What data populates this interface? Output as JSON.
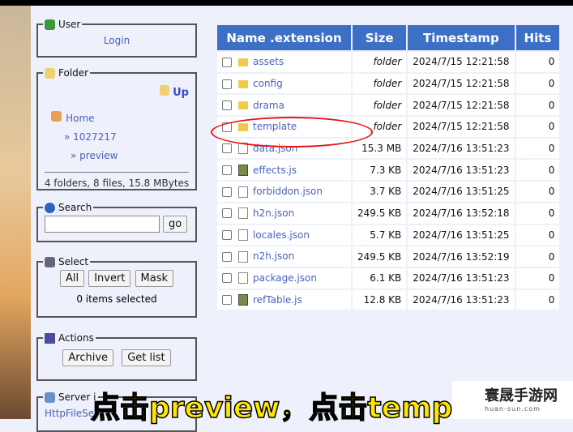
{
  "sidebar": {
    "user": {
      "title": "User",
      "login": "Login"
    },
    "folder": {
      "title": "Folder",
      "up": "Up",
      "home": "Home",
      "path": [
        "» 1027217",
        "» preview"
      ],
      "summary": "4 folders, 8 files, 15.8 MBytes"
    },
    "search": {
      "title": "Search",
      "value": "",
      "go": "go"
    },
    "select": {
      "title": "Select",
      "all": "All",
      "invert": "Invert",
      "mask": "Mask",
      "status": "0 items selected"
    },
    "actions": {
      "title": "Actions",
      "archive": "Archive",
      "getlist": "Get list"
    },
    "server": {
      "title": "Server i",
      "link": "HttpFileSe"
    }
  },
  "table": {
    "headers": [
      "Name .extension",
      "Size",
      "Timestamp",
      "Hits"
    ],
    "rows": [
      {
        "name": "assets",
        "type": "folder",
        "size": "folder",
        "time": "2024/7/15 12:21:58",
        "hits": "0"
      },
      {
        "name": "config",
        "type": "folder",
        "size": "folder",
        "time": "2024/7/15 12:21:58",
        "hits": "0"
      },
      {
        "name": "drama",
        "type": "folder",
        "size": "folder",
        "time": "2024/7/15 12:21:58",
        "hits": "0"
      },
      {
        "name": "template",
        "type": "folder",
        "size": "folder",
        "time": "2024/7/15 12:21:58",
        "hits": "0"
      },
      {
        "name": "data.json",
        "type": "file",
        "size": "15.3 MB",
        "time": "2024/7/16 13:51:23",
        "hits": "0"
      },
      {
        "name": "effects.js",
        "type": "js",
        "size": "7.3 KB",
        "time": "2024/7/16 13:51:23",
        "hits": "0"
      },
      {
        "name": "forbiddon.json",
        "type": "file",
        "size": "3.7 KB",
        "time": "2024/7/16 13:51:25",
        "hits": "0"
      },
      {
        "name": "h2n.json",
        "type": "file",
        "size": "249.5 KB",
        "time": "2024/7/16 13:52:18",
        "hits": "0"
      },
      {
        "name": "locales.json",
        "type": "file",
        "size": "5.7 KB",
        "time": "2024/7/16 13:51:25",
        "hits": "0"
      },
      {
        "name": "n2h.json",
        "type": "file",
        "size": "249.5 KB",
        "time": "2024/7/16 13:52:19",
        "hits": "0"
      },
      {
        "name": "package.json",
        "type": "file",
        "size": "6.1 KB",
        "time": "2024/7/16 13:51:23",
        "hits": "0"
      },
      {
        "name": "refTable.js",
        "type": "js",
        "size": "12.8 KB",
        "time": "2024/7/16 13:51:23",
        "hits": "0"
      }
    ]
  },
  "overlay": {
    "subtitle": "点击preview，点击temp",
    "watermark": "寰晟手游网",
    "watermark_url": "huan-sun.com"
  },
  "colors": {
    "header": "#3d6fc6",
    "link": "#4a62b8",
    "annotation": "#ee1111",
    "subtitle": "#ffe600"
  }
}
